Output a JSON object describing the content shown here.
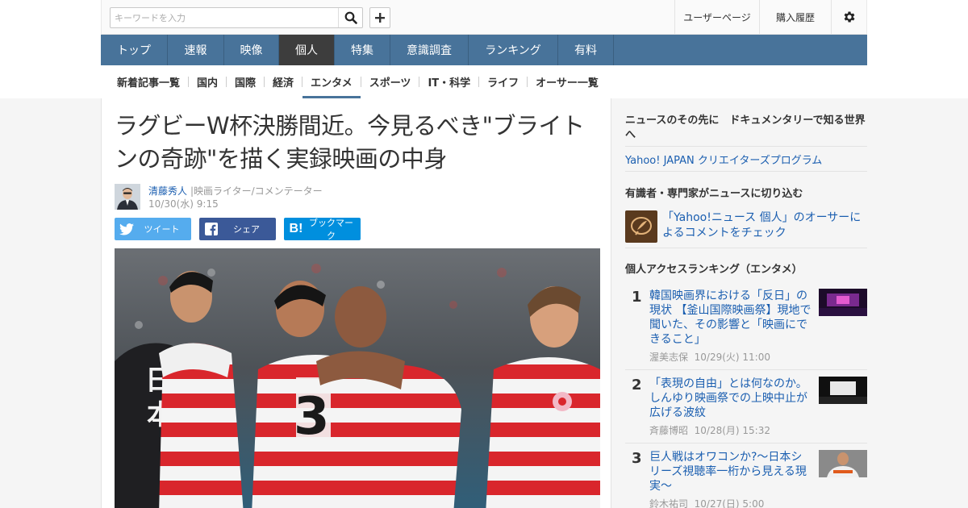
{
  "header": {
    "search_placeholder": "キーワードを入力",
    "user_page": "ユーザーページ",
    "purchase_history": "購入履歴"
  },
  "main_nav": [
    "トップ",
    "速報",
    "映像",
    "個人",
    "特集",
    "意識調査",
    "ランキング",
    "有料"
  ],
  "main_nav_active": "個人",
  "sub_nav": [
    "新着記事一覧",
    "国内",
    "国際",
    "経済",
    "エンタメ",
    "スポーツ",
    "IT・科学",
    "ライフ",
    "オーサー一覧"
  ],
  "sub_nav_active": "エンタメ",
  "article": {
    "title": "ラグビーW杯決勝間近。今見るべき\"ブライトンの奇跡\"を描く実録映画の中身",
    "author_name": "清藤秀人",
    "author_role": "|映画ライター/コメンテーター",
    "date": "10/30(水) 9:15",
    "share_tweet": "ツイート",
    "share_facebook": "シェア",
    "share_bookmark": "ブックマーク"
  },
  "sidebar": {
    "doc_heading": "ニュースのその先に　ドキュメンタリーで知る世界へ",
    "doc_link": "Yahoo! JAPAN クリエイターズプログラム",
    "expert_heading": "有識者・専門家がニュースに切り込む",
    "expert_link": "「Yahoo!ニュース 個人」のオーサーによるコメントをチェック",
    "ranking_heading": "個人アクセスランキング（エンタメ）",
    "ranking": [
      {
        "rank": "1",
        "title": "韓国映画界における「反日」の現状 【釜山国際映画祭】現地で聞いた、その影響と「映画にできること」",
        "author": "渥美志保",
        "date": "10/29(火) 11:00"
      },
      {
        "rank": "2",
        "title": "「表現の自由」とは何なのか。しんゆり映画祭での上映中止が広げる波紋",
        "author": "斉藤博昭",
        "date": "10/28(月) 15:32"
      },
      {
        "rank": "3",
        "title": "巨人戦はオワコンか?～日本シリーズ視聴率一桁から見える現実～",
        "author": "鈴木祐司",
        "date": "10/27(日) 5:00"
      }
    ]
  },
  "colors": {
    "nav_blue": "#48739a",
    "nav_active": "#3d3d3d",
    "link": "#1a5eb0",
    "twitter": "#55acee",
    "facebook": "#3b5998",
    "hatena": "#008fde"
  }
}
